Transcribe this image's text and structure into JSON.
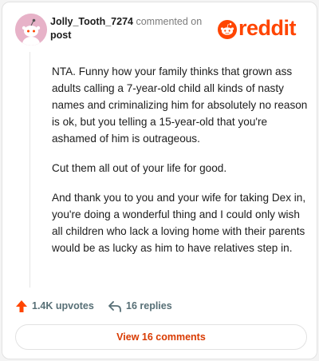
{
  "header": {
    "username": "Jolly_Tooth_7274",
    "action_text": "commented on",
    "target_link": "post",
    "logo_text": "reddit"
  },
  "comment": {
    "paragraphs": [
      "NTA. Funny how your family thinks that grown ass adults calling a 7-year-old child all kinds of nasty names and criminalizing him for absolutely no reason is ok, but you telling a 15-year-old that you're ashamed of him is outrageous.",
      "Cut them all out of your life for good.",
      "And thank you to you and your wife for taking Dex in, you're doing a wonderful thing and I could only wish all children who lack a loving home with their parents would be as lucky as him to have relatives step in."
    ]
  },
  "actions": {
    "upvotes": "1.4K upvotes",
    "replies": "16 replies"
  },
  "footer": {
    "view_comments": "View 16 comments"
  },
  "colors": {
    "brand": "#ff4500",
    "link_orange": "#d93a00",
    "avatar_bg": "#e7b2c8"
  },
  "icons": {
    "avatar": "snoo-avatar",
    "logo": "reddit-snoo-logo",
    "upvote": "upvote-arrow-icon",
    "reply": "reply-arrow-icon"
  }
}
